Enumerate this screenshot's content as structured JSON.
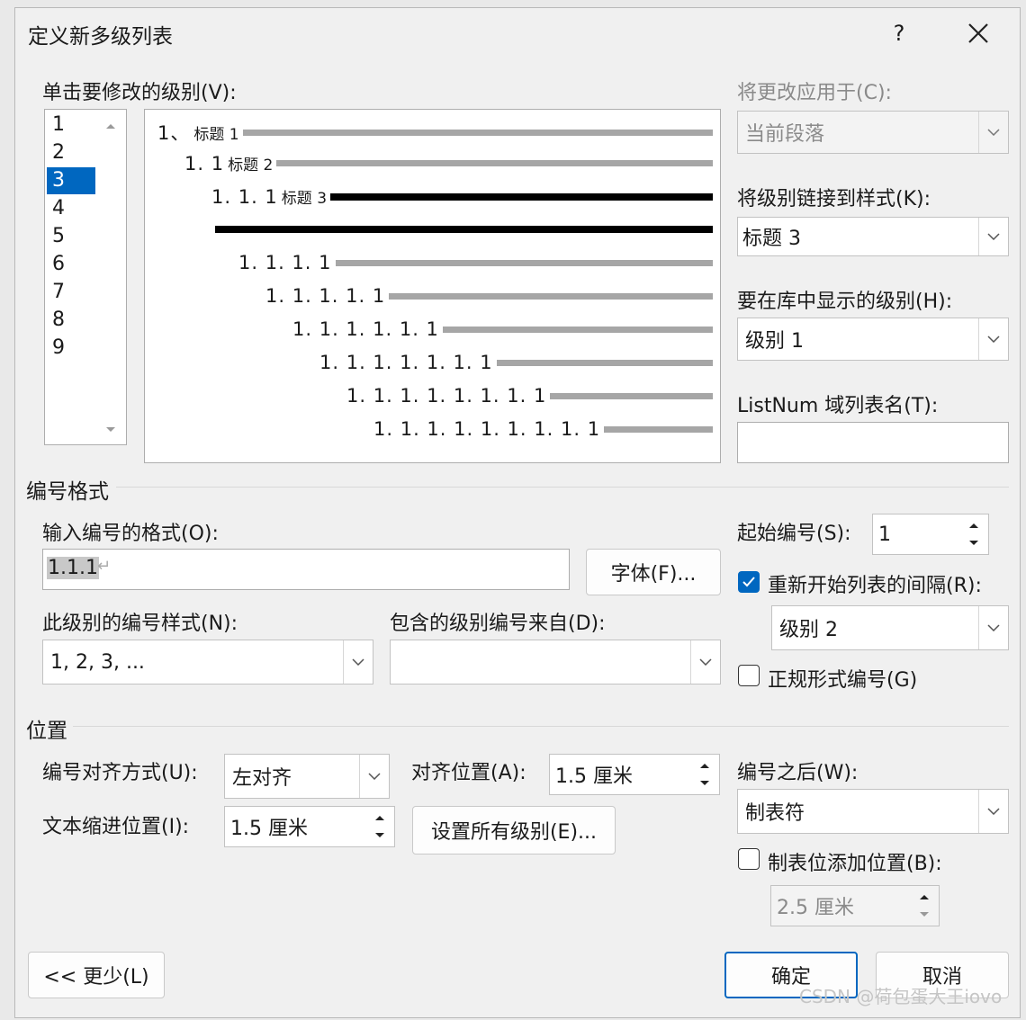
{
  "dialog": {
    "title": "定义新多级列表",
    "help": "?"
  },
  "levels": {
    "label": "单击要修改的级别(V):",
    "items": [
      "1",
      "2",
      "3",
      "4",
      "5",
      "6",
      "7",
      "8",
      "9"
    ],
    "selected": "3"
  },
  "preview": {
    "rows": [
      {
        "num": "1、",
        "heading": "标题 1"
      },
      {
        "num": "1. 1",
        "heading": "标题 2"
      },
      {
        "num": "1. 1. 1",
        "heading": "标题 3"
      },
      {
        "num": "1. 1. 1. 1",
        "heading": ""
      },
      {
        "num": "1. 1. 1. 1. 1",
        "heading": ""
      },
      {
        "num": "1. 1. 1. 1. 1. 1",
        "heading": ""
      },
      {
        "num": "1. 1. 1. 1. 1. 1. 1",
        "heading": ""
      },
      {
        "num": "1. 1. 1. 1. 1. 1. 1. 1",
        "heading": ""
      },
      {
        "num": "1. 1. 1. 1. 1. 1. 1. 1. 1",
        "heading": ""
      }
    ]
  },
  "right_panel": {
    "apply_to_label": "将更改应用于(C):",
    "apply_to_value": "当前段落",
    "link_style_label": "将级别链接到样式(K):",
    "link_style_value": "标题 3",
    "gallery_level_label": "要在库中显示的级别(H):",
    "gallery_level_value": "级别 1",
    "listnum_label": "ListNum 域列表名(T):",
    "listnum_value": ""
  },
  "number_format": {
    "section_title": "编号格式",
    "format_label": "输入编号的格式(O):",
    "format_value": "1.1.1",
    "font_button": "字体(F)...",
    "style_label": "此级别的编号样式(N):",
    "style_value": "1, 2, 3, ...",
    "include_label": "包含的级别编号来自(D):",
    "include_value": "",
    "start_label": "起始编号(S):",
    "start_value": "1",
    "restart_label": "重新开始列表的间隔(R):",
    "restart_checked": true,
    "restart_value": "级别 2",
    "legal_label": "正规形式编号(G)",
    "legal_checked": false
  },
  "position": {
    "section_title": "位置",
    "align_label": "编号对齐方式(U):",
    "align_value": "左对齐",
    "align_at_label": "对齐位置(A):",
    "align_at_value": "1.5 厘米",
    "indent_label": "文本缩进位置(I):",
    "indent_value": "1.5 厘米",
    "set_all_button": "设置所有级别(E)...",
    "follow_label": "编号之后(W):",
    "follow_value": "制表符",
    "tab_stop_label": "制表位添加位置(B):",
    "tab_stop_checked": false,
    "tab_stop_value": "2.5 厘米"
  },
  "footer": {
    "less_button": "<< 更少(L)",
    "ok_button": "确定",
    "cancel_button": "取消"
  },
  "watermark": "CSDN @荷包蛋大王iovo",
  "colors": {
    "accent": "#0067c0",
    "dialog_bg": "#f0f0f0"
  }
}
